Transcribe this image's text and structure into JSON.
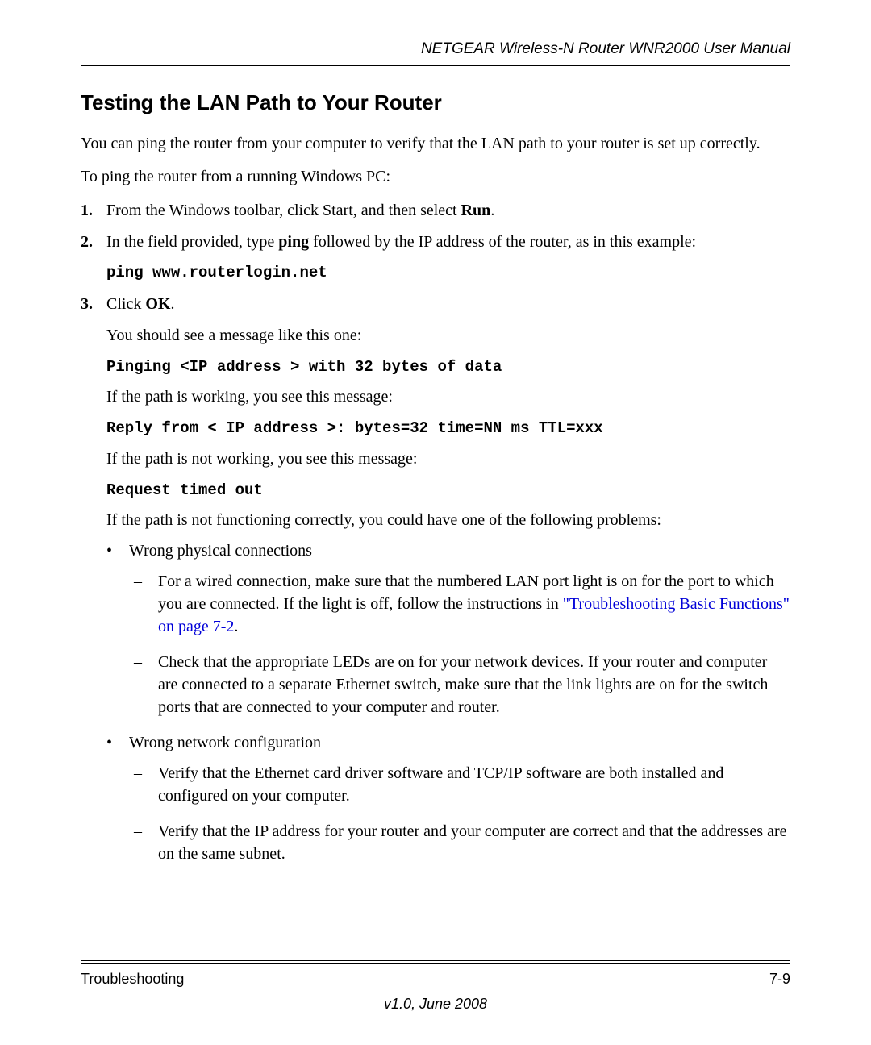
{
  "header": {
    "doc_title": "NETGEAR Wireless-N Router WNR2000 User Manual"
  },
  "section": {
    "heading": "Testing the LAN Path to Your Router",
    "intro": "You can ping the router from your computer to verify that the LAN path to your router is set up correctly.",
    "lead_in": "To ping the router from a running Windows PC:"
  },
  "steps": {
    "s1_a": "From the Windows toolbar, click Start, and then select ",
    "s1_b": "Run",
    "s1_c": ".",
    "s2_a": "In the field provided, type ",
    "s2_b": "ping",
    "s2_c": " followed by the IP address of the router, as in this example:",
    "s2_code": "ping www.routerlogin.net",
    "s3_a": "Click ",
    "s3_b": "OK",
    "s3_c": "."
  },
  "after": {
    "msg_intro": "You should see a message like this one:",
    "msg1": "Pinging <IP address > with 32 bytes of data",
    "path_ok": "If the path is working, you see this message:",
    "msg2": "Reply from < IP address >: bytes=32 time=NN ms TTL=xxx",
    "path_bad": "If the path is not working, you see this message:",
    "msg3": "Request timed out",
    "problems_intro": "If the path is not functioning correctly, you could have one of the following problems:"
  },
  "bullets": {
    "b1": "Wrong physical connections",
    "b1d1_a": "For a wired connection, make sure that the numbered LAN port light is on for the port to which you are connected. If the light is off, follow the instructions in ",
    "b1d1_link": "\"Troubleshooting Basic Functions\" on page 7-2",
    "b1d1_b": ".",
    "b1d2": "Check that the appropriate LEDs are on for your network devices. If your router and computer are connected to a separate Ethernet switch, make sure that the link lights are on for the switch ports that are connected to your computer and router.",
    "b2": "Wrong network configuration",
    "b2d1": "Verify that the Ethernet card driver software and TCP/IP software are both installed and configured on your computer.",
    "b2d2": "Verify that the IP address for your router and your computer are correct and that the addresses are on the same subnet."
  },
  "footer": {
    "section_name": "Troubleshooting",
    "page_num": "7-9",
    "version": "v1.0, June 2008"
  }
}
